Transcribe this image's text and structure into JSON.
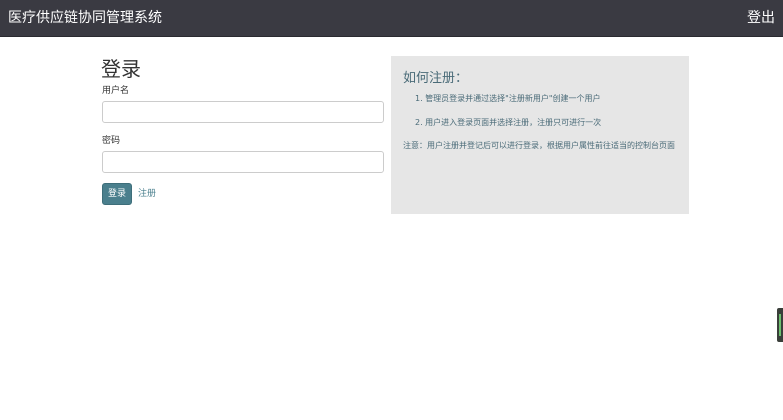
{
  "navbar": {
    "brand": "医疗供应链协同管理系统",
    "logout_label": "登出"
  },
  "login": {
    "title": "登录",
    "username_label": "用户名",
    "username_value": "",
    "username_placeholder": "",
    "password_label": "密码",
    "password_value": "",
    "password_placeholder": "",
    "submit_label": "登录",
    "register_label": "注册"
  },
  "help": {
    "title": "如何注册：",
    "steps": [
      "1. 管理员登录并通过选择\"注册新用户\"创建一个用户",
      "2. 用户进入登录页面并选择注册，注册只可进行一次"
    ],
    "note": "注意：用户注册并登记后可以进行登录，根据用户属性前往适当的控制台页面"
  },
  "colors": {
    "navbar_bg": "#3a3a42",
    "accent": "#4a7f8d",
    "panel_bg": "#e6e6e6"
  }
}
